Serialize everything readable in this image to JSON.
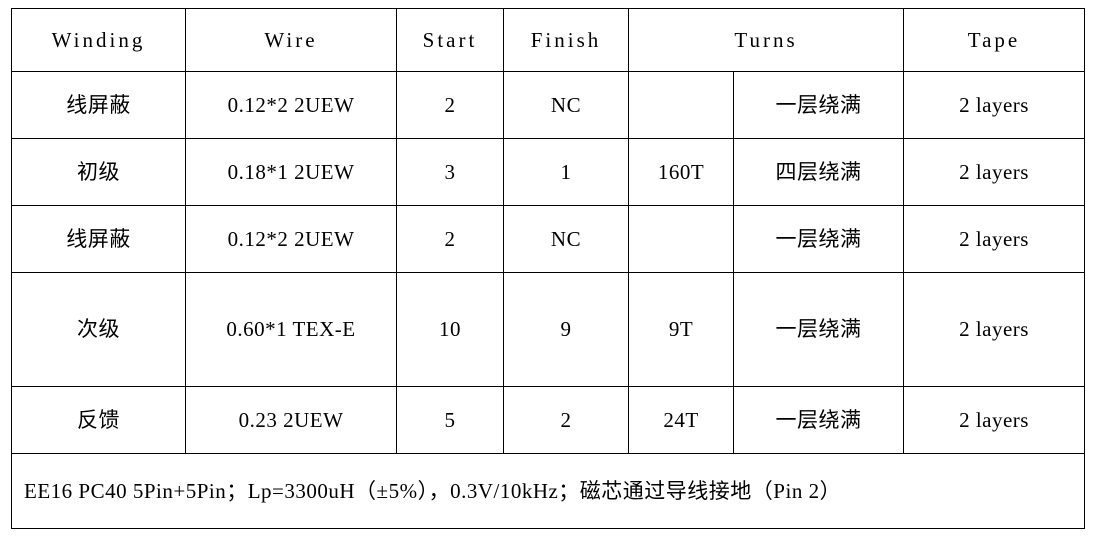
{
  "table": {
    "headers": {
      "winding": "Winding",
      "wire": "Wire",
      "start": "Start",
      "finish": "Finish",
      "turns": "Turns",
      "tape": "Tape"
    },
    "rows": [
      {
        "winding": "线屏蔽",
        "wire": "0.12*2  2UEW",
        "start": "2",
        "finish": "NC",
        "turns_count": "",
        "turns_desc": "一层绕满",
        "tape": "2 layers"
      },
      {
        "winding": "初级",
        "wire": "0.18*1  2UEW",
        "start": "3",
        "finish": "1",
        "turns_count": "160T",
        "turns_desc": "四层绕满",
        "tape": "2 layers"
      },
      {
        "winding": "线屏蔽",
        "wire": "0.12*2  2UEW",
        "start": "2",
        "finish": "NC",
        "turns_count": "",
        "turns_desc": "一层绕满",
        "tape": "2 layers"
      },
      {
        "winding": "次级",
        "wire": "0.60*1  TEX-E",
        "start": "10",
        "finish": "9",
        "turns_count": "9T",
        "turns_desc": "一层绕满",
        "tape": "2 layers"
      },
      {
        "winding": "反馈",
        "wire": "0.23  2UEW",
        "start": "5",
        "finish": "2",
        "turns_count": "24T",
        "turns_desc": "一层绕满",
        "tape": "2 layers"
      }
    ],
    "note": "EE16 PC40 5Pin+5Pin；Lp=3300uH（±5%），0.3V/10kHz；磁芯通过导线接地（Pin 2）"
  }
}
